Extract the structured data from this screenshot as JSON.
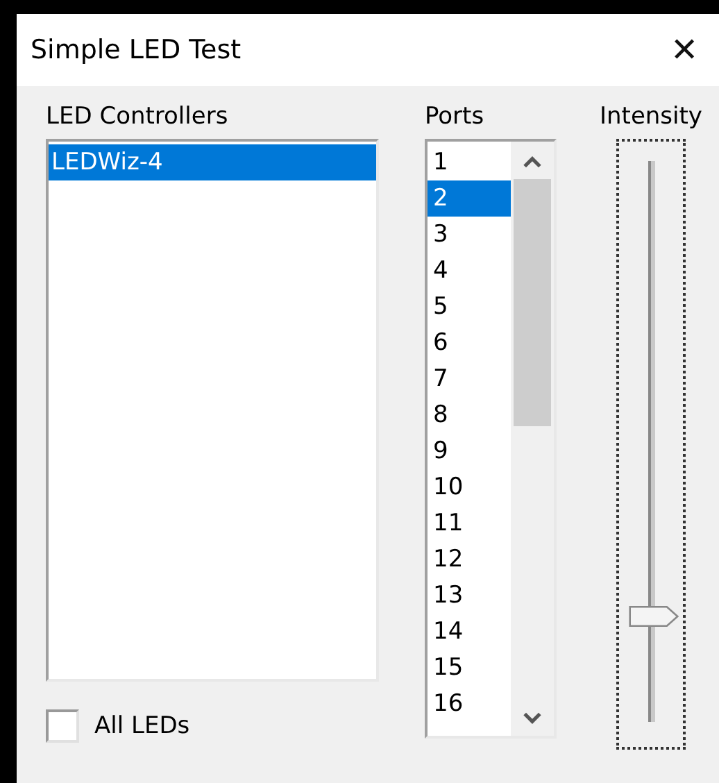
{
  "window": {
    "title": "Simple LED Test",
    "close_glyph": "✕"
  },
  "controllers": {
    "label": "LED Controllers",
    "items": [
      {
        "label": "LEDWiz-4",
        "selected": true
      }
    ]
  },
  "ports": {
    "label": "Ports",
    "items": [
      {
        "label": "1",
        "selected": false
      },
      {
        "label": "2",
        "selected": true
      },
      {
        "label": "3",
        "selected": false
      },
      {
        "label": "4",
        "selected": false
      },
      {
        "label": "5",
        "selected": false
      },
      {
        "label": "6",
        "selected": false
      },
      {
        "label": "7",
        "selected": false
      },
      {
        "label": "8",
        "selected": false
      },
      {
        "label": "9",
        "selected": false
      },
      {
        "label": "10",
        "selected": false
      },
      {
        "label": "11",
        "selected": false
      },
      {
        "label": "12",
        "selected": false
      },
      {
        "label": "13",
        "selected": false
      },
      {
        "label": "14",
        "selected": false
      },
      {
        "label": "15",
        "selected": false
      },
      {
        "label": "16",
        "selected": false
      }
    ]
  },
  "intensity": {
    "label": "Intensity",
    "level": 0.19
  },
  "all_leds": {
    "label": "All LEDs",
    "checked": false
  }
}
